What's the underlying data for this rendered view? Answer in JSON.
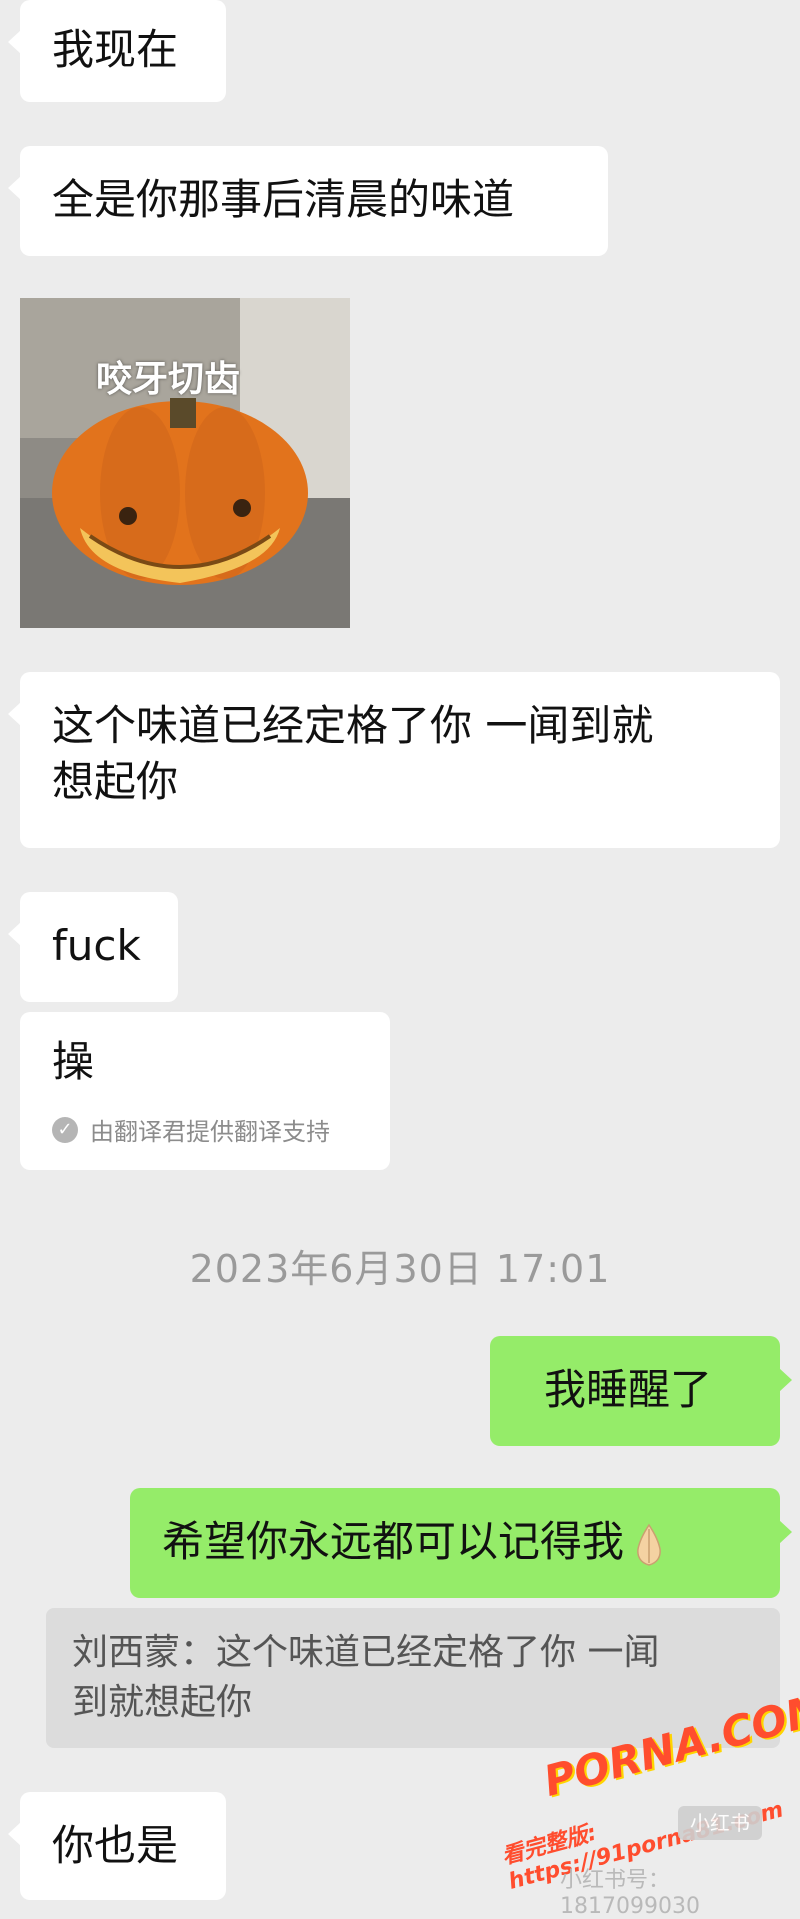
{
  "messages": {
    "m1": "我现在",
    "m2": "全是你那事后清晨的味道",
    "sticker_caption": "咬牙切齿",
    "m3_line1": "这个味道已经定格了你  一闻到就",
    "m3_line2": "想起你",
    "m4": "fuck",
    "m4_translation": "操",
    "translation_note": "由翻译君提供翻译支持",
    "timestamp": "2023年6月30日 17:01",
    "out1": "我睡醒了",
    "out2": "希望你永远都可以记得我",
    "quote_line1": "刘西蒙：这个味道已经定格了你  一闻",
    "quote_line2": "到就想起你",
    "m5": "你也是"
  },
  "watermark": {
    "brand": "PORNA.COM",
    "url_text": "看完整版: https://91porna81.com",
    "badge": "小红书",
    "id_text": "小红书号：1817099030"
  },
  "colors": {
    "background": "#ececec",
    "incoming_bubble": "#ffffff",
    "outgoing_bubble": "#95ec69",
    "pumpkin": "#e2731c"
  }
}
